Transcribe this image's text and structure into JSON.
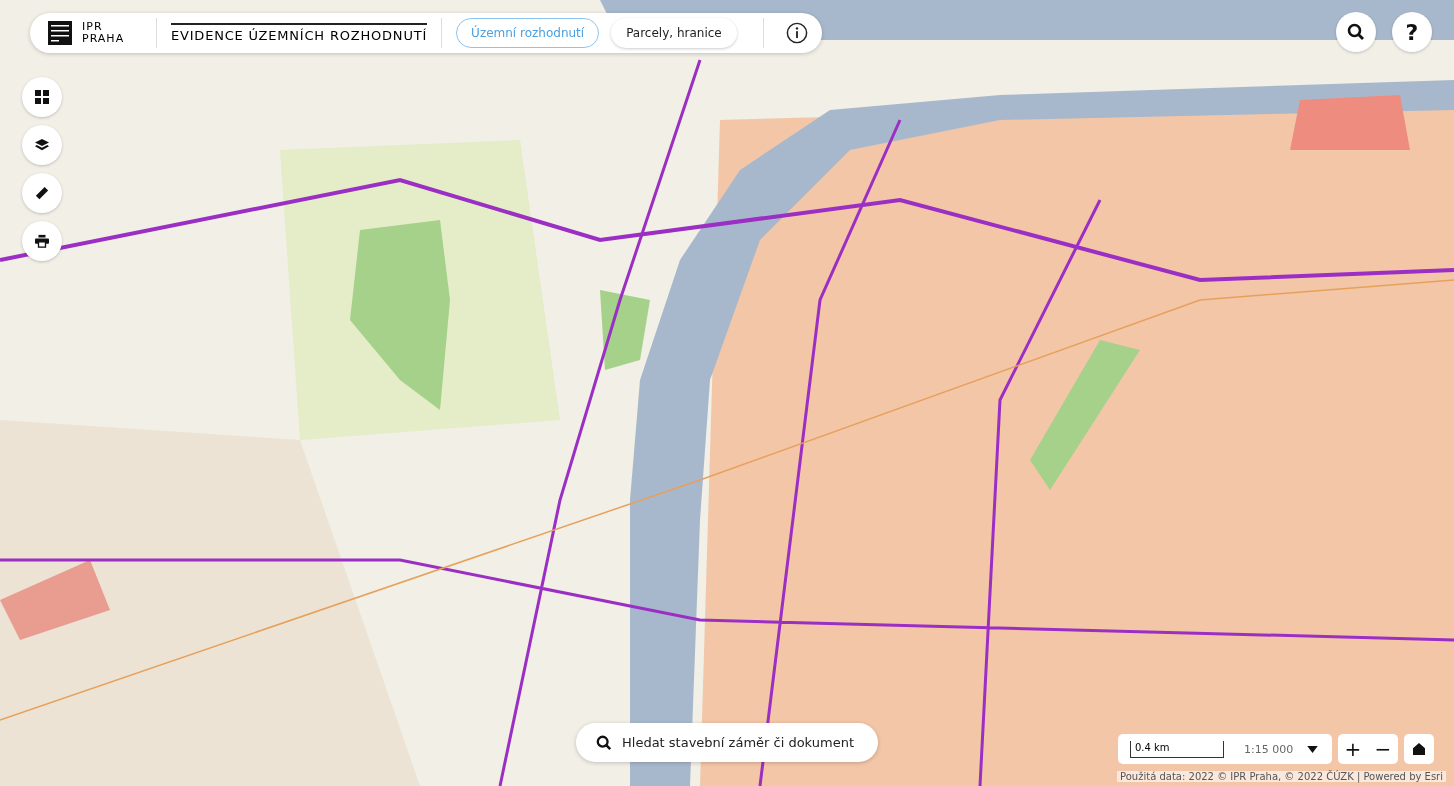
{
  "header": {
    "brand": [
      "IPR",
      "PRAHA"
    ],
    "title": "EVIDENCE ÚZEMNÍCH ROZHODNUTÍ",
    "tabs": [
      {
        "label": "Územní rozhodnutí",
        "selected": true
      },
      {
        "label": "Parcely, hranice",
        "selected": false
      }
    ]
  },
  "help": {
    "label": "?"
  },
  "search": {
    "placeholder": "Hledat stavební záměr či dokument"
  },
  "scale": {
    "bar_label": "0.4 km",
    "ratio": "1:15 000"
  },
  "zoom": {
    "in_label": "+",
    "out_label": "−"
  },
  "attribution": "Použitá data: 2022 © IPR Praha, © 2022 ČÚZK | Powered by Esri"
}
